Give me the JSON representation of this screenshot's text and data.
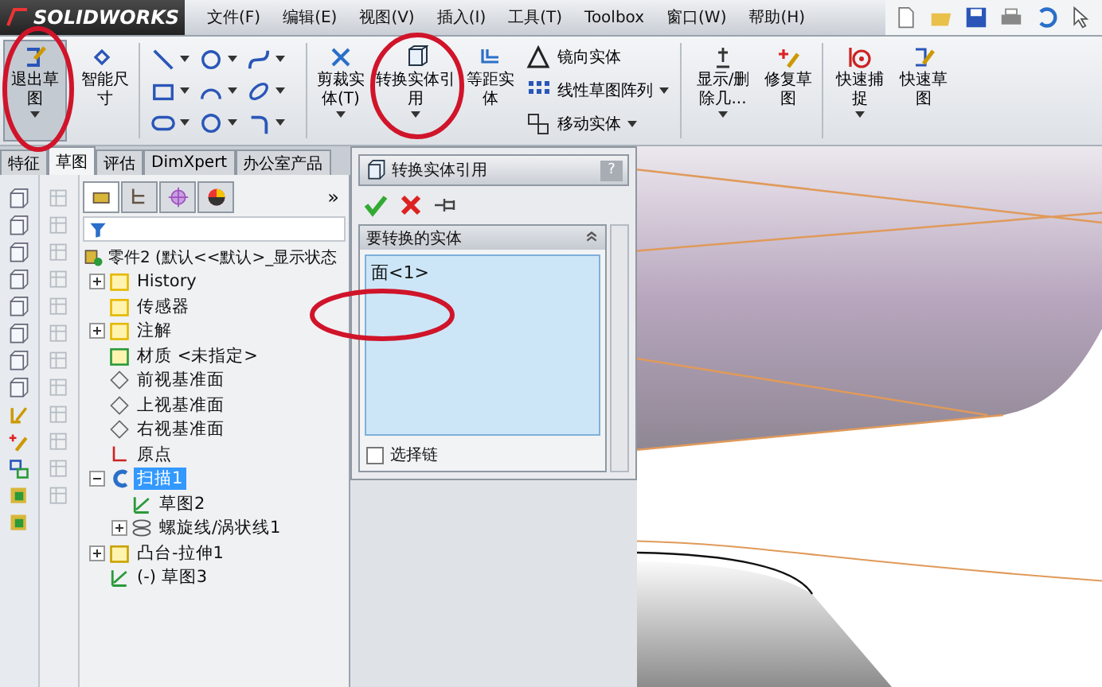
{
  "app": {
    "logo": "SOLIDWORKS"
  },
  "menu": [
    "文件(F)",
    "编辑(E)",
    "视图(V)",
    "插入(I)",
    "工具(T)",
    "Toolbox",
    "窗口(W)",
    "帮助(H)"
  ],
  "ribbon": {
    "exit_sketch": {
      "label": "退出草图",
      "pressed": true
    },
    "smart_dimension": {
      "label": "智能尺寸"
    },
    "large_buttons": [
      {
        "label": "剪裁实体(T)",
        "kind": "trim",
        "dropdown": true
      },
      {
        "label": "转换实体引用",
        "kind": "convert",
        "dropdown": true
      },
      {
        "label": "等距实体",
        "kind": "offset",
        "dropdown": false
      }
    ],
    "list_buttons": [
      {
        "label": "镜向实体",
        "kind": "mirror",
        "dropdown": false
      },
      {
        "label": "线性草图阵列",
        "kind": "pattern",
        "dropdown": true
      },
      {
        "label": "移动实体",
        "kind": "move",
        "dropdown": true
      }
    ],
    "extra_buttons": [
      {
        "label": "显示/删除几...",
        "kind": "relations",
        "dropdown": true
      },
      {
        "label": "修复草图",
        "kind": "repair",
        "dropdown": false
      },
      {
        "label": "快速捕捉",
        "kind": "snap",
        "dropdown": true
      },
      {
        "label": "快速草图",
        "kind": "quick",
        "dropdown": false
      }
    ]
  },
  "tabs": [
    {
      "label": "特征",
      "selected": false
    },
    {
      "label": "草图",
      "selected": true
    },
    {
      "label": "评估",
      "selected": false
    },
    {
      "label": "DimXpert",
      "selected": false
    },
    {
      "label": "办公室产品",
      "selected": false
    }
  ],
  "tree": {
    "more": "»",
    "root": {
      "label": "零件2  (默认<<默认>_显示状态",
      "children": [
        {
          "label": "History",
          "kind": "history",
          "expandable": true,
          "expanded": false,
          "selected": false
        },
        {
          "label": "传感器",
          "kind": "sensor",
          "expandable": false,
          "selected": false
        },
        {
          "label": "注解",
          "kind": "annotation",
          "expandable": true,
          "expanded": false,
          "selected": false
        },
        {
          "label": "材质 <未指定>",
          "kind": "material",
          "expandable": false,
          "selected": false
        },
        {
          "label": "前视基准面",
          "kind": "plane",
          "expandable": false,
          "selected": false
        },
        {
          "label": "上视基准面",
          "kind": "plane",
          "expandable": false,
          "selected": false
        },
        {
          "label": "右视基准面",
          "kind": "plane",
          "expandable": false,
          "selected": false
        },
        {
          "label": "原点",
          "kind": "origin",
          "expandable": false,
          "selected": false
        },
        {
          "label": "扫描1",
          "kind": "sweep",
          "expandable": true,
          "expanded": true,
          "selected": true,
          "children": [
            {
              "label": "草图2",
              "kind": "sketch",
              "expandable": false,
              "selected": false
            },
            {
              "label": "螺旋线/涡状线1",
              "kind": "helix",
              "expandable": true,
              "expanded": false,
              "selected": false
            }
          ]
        },
        {
          "label": "凸台-拉伸1",
          "kind": "extrude",
          "expandable": true,
          "expanded": false,
          "selected": false
        },
        {
          "label": "(-) 草图3",
          "kind": "sketch",
          "expandable": false,
          "selected": false
        }
      ]
    }
  },
  "property_manager": {
    "title": "转换实体引用",
    "help": "?",
    "group": {
      "title": "要转换的实体",
      "items": [
        "面<1>"
      ]
    },
    "select_chain": {
      "label": "选择链",
      "checked": false
    }
  }
}
